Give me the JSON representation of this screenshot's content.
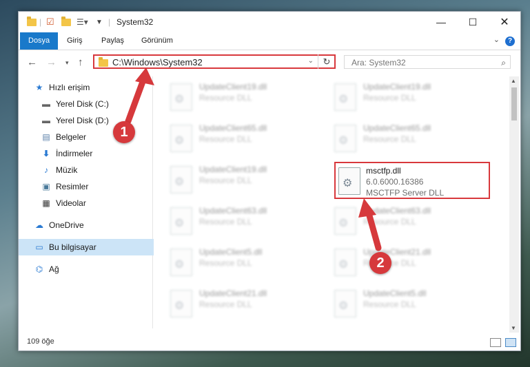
{
  "window": {
    "title": "System32"
  },
  "ribbon": {
    "tabs": [
      "Dosya",
      "Giriş",
      "Paylaş",
      "Görünüm"
    ]
  },
  "address": {
    "path": "C:\\Windows\\System32"
  },
  "search": {
    "placeholder": "Ara: System32"
  },
  "sidebar": {
    "items": [
      {
        "label": "Hızlı erişim",
        "icon": "star-icon"
      },
      {
        "label": "Yerel Disk (C:)",
        "icon": "drive-icon",
        "pinned": true
      },
      {
        "label": "Yerel Disk (D:)",
        "icon": "drive-icon",
        "pinned": true
      },
      {
        "label": "Belgeler",
        "icon": "document-icon",
        "pinned": true
      },
      {
        "label": "İndirmeler",
        "icon": "download-icon",
        "pinned": true
      },
      {
        "label": "Müzik",
        "icon": "music-icon",
        "pinned": true
      },
      {
        "label": "Resimler",
        "icon": "picture-icon",
        "pinned": true
      },
      {
        "label": "Videolar",
        "icon": "video-icon",
        "pinned": true
      },
      {
        "label": "OneDrive",
        "icon": "cloud-icon"
      },
      {
        "label": "Bu bilgisayar",
        "icon": "computer-icon",
        "selected": true
      },
      {
        "label": "Ağ",
        "icon": "network-icon"
      }
    ]
  },
  "files": {
    "left": [
      {
        "name": "UpdateClient19.dll",
        "desc": "Resource DLL"
      },
      {
        "name": "UpdateClient65.dll",
        "desc": "Resource DLL"
      },
      {
        "name": "UpdateClient19.dll",
        "desc": "Resource DLL"
      },
      {
        "name": "UpdateClient63.dll",
        "desc": "Resource DLL"
      },
      {
        "name": "UpdateClient5.dll",
        "desc": "Resource DLL"
      },
      {
        "name": "UpdateClient21.dll",
        "desc": "Resource DLL"
      }
    ],
    "right": [
      {
        "name": "UpdateClient19.dll",
        "desc": "Resource DLL"
      },
      {
        "name": "UpdateClient65.dll",
        "desc": "Resource DLL"
      },
      {
        "name": "msctfp.dll",
        "version": "6.0.6000.16386",
        "desc": "MSCTFP Server DLL",
        "highlight": true
      },
      {
        "name": "UpdateClient63.dll",
        "desc": "Resource DLL"
      },
      {
        "name": "UpdateClient21.dll",
        "desc": "Resource DLL"
      },
      {
        "name": "UpdateClient5.dll",
        "desc": "Resource DLL"
      }
    ]
  },
  "status": {
    "count": "109 öğe"
  },
  "annotations": {
    "step1": "1",
    "step2": "2"
  },
  "colors": {
    "accent": "#1979ca",
    "highlight": "#d8383c",
    "selected": "#cce4f7"
  }
}
